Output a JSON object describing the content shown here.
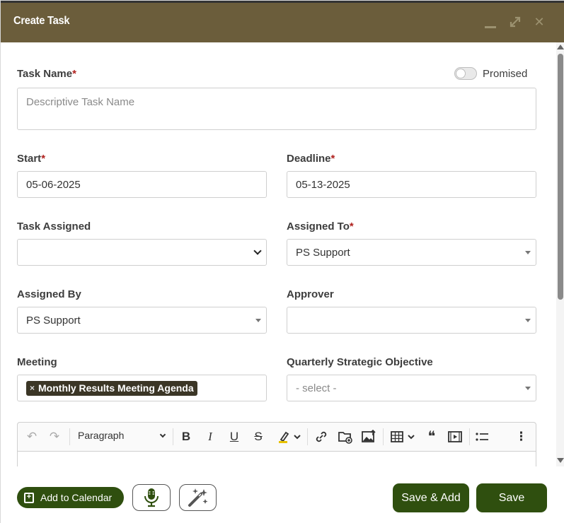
{
  "window": {
    "title": "Create Task",
    "min_icon": "minimize-icon",
    "max_icon": "maximize-icon",
    "close_icon": "close-icon"
  },
  "form": {
    "task_name": {
      "label": "Task Name",
      "required": "*",
      "placeholder": "Descriptive Task Name",
      "value": ""
    },
    "promised": {
      "label": "Promised",
      "checked": false
    },
    "start": {
      "label": "Start",
      "required": "*",
      "value": "05-06-2025"
    },
    "deadline": {
      "label": "Deadline",
      "required": "*",
      "value": "05-13-2025"
    },
    "task_assigned": {
      "label": "Task Assigned",
      "value": ""
    },
    "assigned_to": {
      "label": "Assigned To",
      "required": "*",
      "value": "PS Support"
    },
    "assigned_by": {
      "label": "Assigned By",
      "value": "PS Support"
    },
    "approver": {
      "label": "Approver",
      "value": ""
    },
    "meeting": {
      "label": "Meeting",
      "tags": [
        {
          "remove": "×",
          "label": "Monthly Results Meeting Agenda"
        }
      ]
    },
    "qso": {
      "label": "Quarterly Strategic Objective",
      "placeholder": "- select -"
    }
  },
  "editor": {
    "block_format": "Paragraph",
    "tools": [
      "undo-icon",
      "redo-icon",
      "bold-icon",
      "italic-icon",
      "underline-icon",
      "strikethrough-icon",
      "highlight-icon",
      "link-icon",
      "folder-upload-icon",
      "image-upload-icon",
      "table-icon",
      "blockquote-icon",
      "media-icon",
      "bulleted-list-icon",
      "more-icon"
    ],
    "glyphs": {
      "undo": "↶",
      "redo": "↷",
      "bold": "B",
      "italic": "I",
      "underline": "U",
      "strike": "S",
      "quote": "❝",
      "more": "⋮"
    }
  },
  "footer": {
    "add_to_calendar": "Add to Calendar",
    "mic_icon": "microphone-icon",
    "wand_icon": "magic-wand-icon",
    "save_and_add": "Save & Add",
    "save": "Save"
  },
  "colors": {
    "titlebar": "#6b5d3b",
    "primary_button": "#2f4f0f",
    "required": "#b0221f",
    "tag": "#3b3626"
  }
}
